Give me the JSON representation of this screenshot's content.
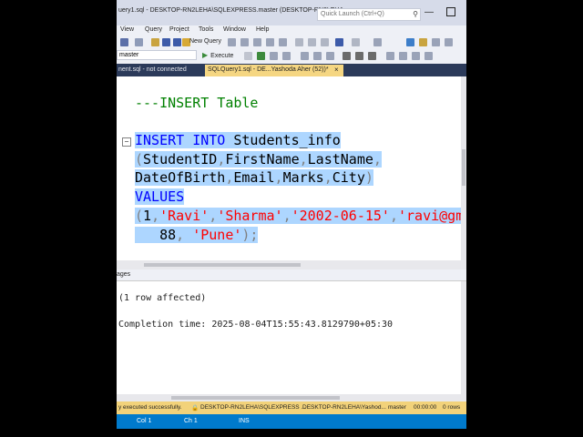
{
  "window": {
    "title": "uery1.sql - DESKTOP-RN2LEHA\\SQLEXPRESS.master (DESKTOP-RN2LEHA...",
    "quick_launch_placeholder": "Quick Launch (Ctrl+Q)"
  },
  "menu": [
    "View",
    "Query",
    "Project",
    "Tools",
    "Window",
    "Help"
  ],
  "toolbar": {
    "new_query_label": "New Query",
    "database_selected": "master",
    "execute_label": "Execute"
  },
  "tabs": [
    {
      "label": "nent.sql - not connected"
    },
    {
      "label": "SQLQuery1.sql - DE...Yashoda Aher (52))*",
      "close": "×"
    }
  ],
  "editor": {
    "comment": "---INSERT Table",
    "line1_kw1": "INSERT",
    "line1_kw2": "INTO",
    "line1_table": "Students_info",
    "line2": {
      "open": "(",
      "c1": "StudentID",
      "c2": "FirstName",
      "c3": "LastName",
      "comma": ","
    },
    "line3": {
      "c4": "DateOfBirth",
      "c5": "Email",
      "c6": "Marks",
      "c7": "City",
      "close": ")"
    },
    "values_kw": "VALUES",
    "line5": {
      "open": "(",
      "v1": "1",
      "v2": "'Ravi'",
      "v3": "'Sharma'",
      "v4": "'2002-06-15'",
      "v5": "'ravi@gma",
      "comma": ","
    },
    "line6": {
      "v6": "88",
      "v7": "'Pune'",
      "close": ");"
    }
  },
  "results": {
    "tab_label": "ages",
    "line1": "(1 row affected)",
    "line2": "Completion time: 2025-08-04T15:55:43.8129790+05:30"
  },
  "query_status": {
    "message": "y executed successfully.",
    "server": "DESKTOP-RN2LEHA\\SQLEXPRESS ...",
    "user": "DESKTOP-RN2LEHA\\Yashod...",
    "database": "master",
    "elapsed": "00:00:00",
    "rows": "0 rows"
  },
  "app_status": {
    "ln": "Col 1",
    "ch": "Ch 1",
    "mode": "INS"
  },
  "colors": {
    "keyword": "#0000ff",
    "string": "#ff0000",
    "comment": "#008000",
    "punct": "#808080",
    "selection": "#add6ff",
    "status_blue": "#007acc",
    "query_status_yellow": "#f2d27a"
  }
}
